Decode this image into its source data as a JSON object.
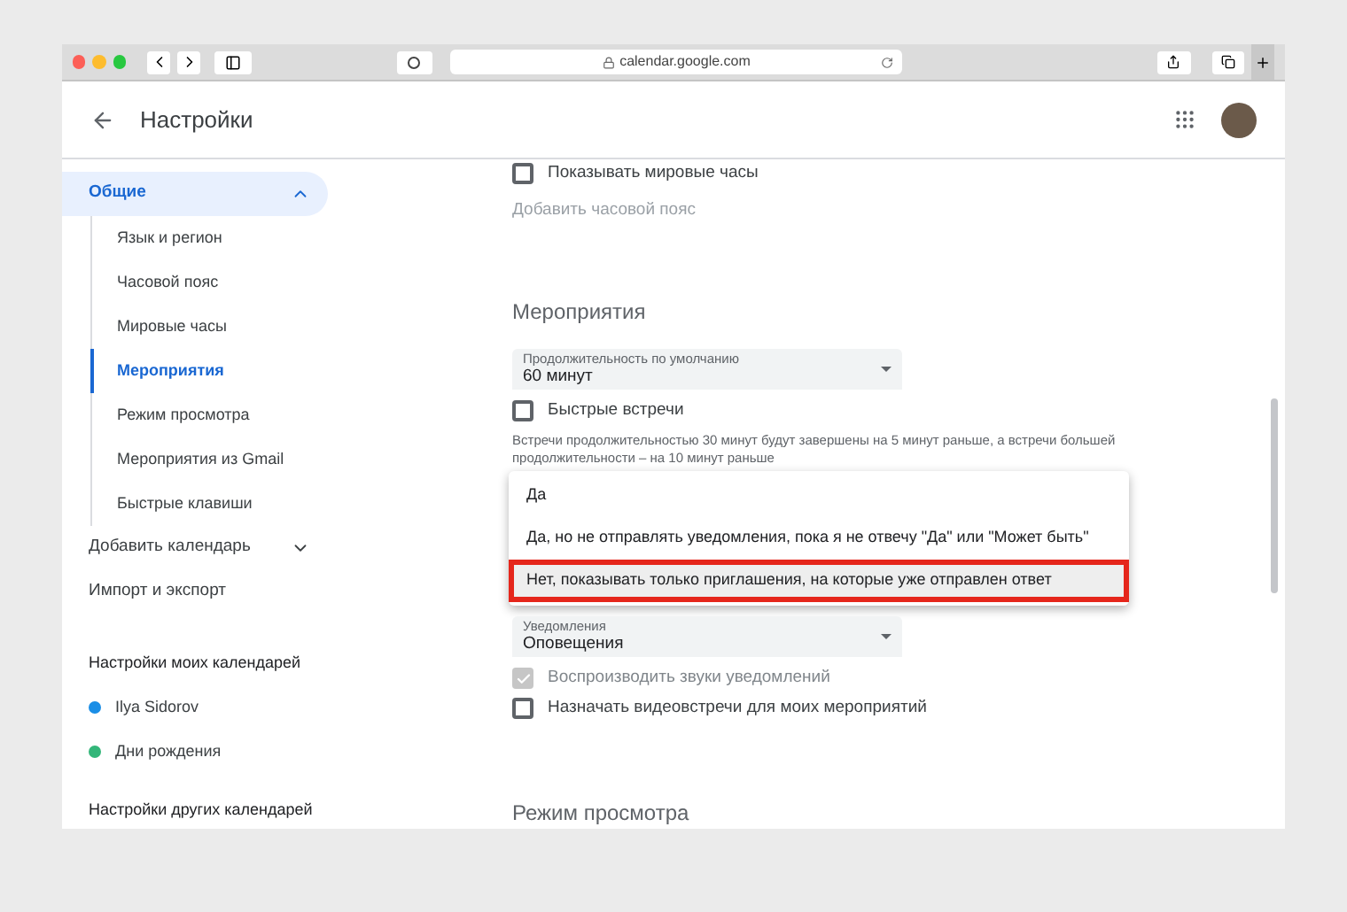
{
  "browser": {
    "url": "calendar.google.com"
  },
  "header": {
    "title": "Настройки"
  },
  "sidebar": {
    "items": [
      {
        "label": "Общие",
        "expanded": true,
        "children": [
          {
            "label": "Язык и регион",
            "selected": false
          },
          {
            "label": "Часовой пояс",
            "selected": false
          },
          {
            "label": "Мировые часы",
            "selected": false
          },
          {
            "label": "Мероприятия",
            "selected": true
          },
          {
            "label": "Режим просмотра",
            "selected": false
          },
          {
            "label": "Мероприятия из Gmail",
            "selected": false
          },
          {
            "label": "Быстрые клавиши",
            "selected": false
          }
        ]
      },
      {
        "label": "Добавить календарь",
        "expanded": false
      },
      {
        "label": "Импорт и экспорт"
      }
    ],
    "my_calendars": {
      "title": "Настройки моих календарей",
      "items": [
        {
          "label": "Ilya Sidorov",
          "color": "#1a8ee6"
        },
        {
          "label": "Дни рождения",
          "color": "#33b679"
        }
      ]
    },
    "other_calendars": {
      "title": "Настройки других календарей"
    }
  },
  "content": [
    {
      "kind": "checkbox",
      "label": "Показывать мировые часы",
      "checked": false,
      "disabled": false
    },
    {
      "kind": "link",
      "label": "Добавить часовой пояс"
    },
    {
      "kind": "heading",
      "label": "Мероприятия"
    },
    {
      "kind": "select",
      "label": "Продолжительность по умолчанию",
      "value": "60 минут"
    },
    {
      "kind": "checkbox",
      "label": "Быстрые встречи",
      "checked": false,
      "disabled": false
    },
    {
      "kind": "note",
      "label": "Встречи продолжительностью 30 минут будут завершены на 5 минут раньше, а встречи большей продолжительности – на 10 минут раньше"
    },
    {
      "kind": "menu",
      "options": [
        {
          "label": "Да",
          "selected": false
        },
        {
          "label": "Да, но не отправлять уведомления, пока я не отвечу \"Да\" или \"Может быть\"",
          "selected": false
        },
        {
          "label": "Нет, показывать только приглашения, на которые уже отправлен ответ",
          "selected": true
        }
      ]
    },
    {
      "kind": "select",
      "label": "Уведомления",
      "value": "Оповещения"
    },
    {
      "kind": "checkbox",
      "label": "Воспроизводить звуки уведомлений",
      "checked": true,
      "disabled": true
    },
    {
      "kind": "checkbox",
      "label": "Назначать видеовстречи для моих мероприятий",
      "checked": false,
      "disabled": false
    },
    {
      "kind": "heading",
      "label": "Режим просмотра"
    }
  ]
}
